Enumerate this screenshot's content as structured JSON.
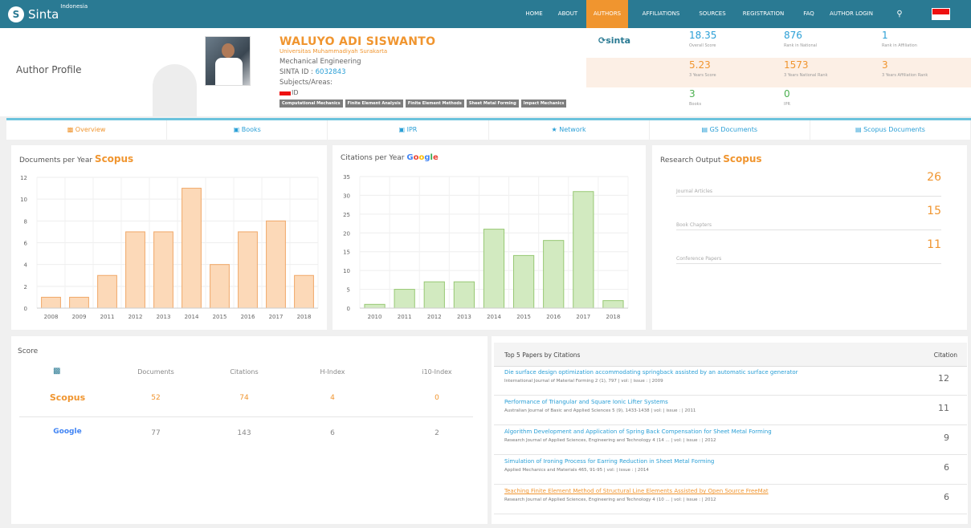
{
  "nav": {
    "logo": "Sinta",
    "logo_sub": "Indonesia",
    "items": [
      "HOME",
      "ABOUT",
      "AUTHORS",
      "AFFILIATIONS",
      "SOURCES",
      "REGISTRATION",
      "FAQ",
      "AUTHOR LOGIN"
    ],
    "active": "AUTHORS",
    "search_icon": "search-icon",
    "flag": "indonesia-flag"
  },
  "page_title": "Author Profile",
  "author": {
    "name": "WALUYO ADI SISWANTO",
    "university": "Universitas Muhammadiyah Surakarta",
    "department": "Mechanical Engineering",
    "sinta_id_label": "SINTA ID : ",
    "sinta_id": "6032843",
    "subjects_label": "Subjects/Areas:",
    "country": "ID",
    "tags": [
      "Computational Mechanics",
      "Finite Element Analysis",
      "Finite Element Methods",
      "Sheet Metal Forming",
      "Impact Mechanics"
    ]
  },
  "sinta_logo": "sinta",
  "metrics": [
    [
      {
        "value": "18.35",
        "label": "Overall Score"
      },
      {
        "value": "876",
        "label": "Rank in National"
      },
      {
        "value": "1",
        "label": "Rank in Affiliation"
      }
    ],
    [
      {
        "value": "5.23",
        "label": "3 Years Score"
      },
      {
        "value": "1573",
        "label": "3 Years National Rank"
      },
      {
        "value": "3",
        "label": "3 Years Affiliation Rank"
      }
    ],
    [
      {
        "value": "3",
        "label": "Books"
      },
      {
        "value": "0",
        "label": "IPR"
      }
    ]
  ],
  "tabs": [
    "Overview",
    "Books",
    "IPR",
    "Network",
    "GS Documents",
    "Scopus Documents"
  ],
  "active_tab": "Overview",
  "docs_card": {
    "title": "Documents per Year",
    "source": "Scopus"
  },
  "cites_card": {
    "title": "Citations per Year",
    "source": "Google"
  },
  "research_output": {
    "title": "Research Output",
    "source": "Scopus",
    "items": [
      {
        "label": "Journal Articles",
        "value": "26"
      },
      {
        "label": "Book Chapters",
        "value": "15"
      },
      {
        "label": "Conference Papers",
        "value": "11"
      }
    ]
  },
  "score": {
    "title": "Score",
    "headers": [
      "Documents",
      "Citations",
      "H-Index",
      "i10-Index"
    ],
    "rows": [
      {
        "source": "Scopus",
        "values": [
          "52",
          "74",
          "4",
          "0"
        ]
      },
      {
        "source": "Google",
        "values": [
          "77",
          "143",
          "6",
          "2"
        ]
      }
    ]
  },
  "top_papers": {
    "title": "Top 5 Papers by Citations",
    "citation_header": "Citation",
    "papers": [
      {
        "title": "Die surface design optimization accommodating springback assisted by an automatic surface generator",
        "source": "International Journal of Material Forming 2 (1), 797 | vol: | issue : | 2009",
        "citations": "12"
      },
      {
        "title": "Performance of Triangular and Square Ionic Lifter Systems",
        "source": "Australian Journal of Basic and Applied Sciences 5 (9), 1433-1438 | vol: | issue : | 2011",
        "citations": "11"
      },
      {
        "title": "Algorithm Development and Application of Spring Back Compensation for Sheet Metal Forming",
        "source": "Research Journal of Applied Sciences, Engineering and Technology 4 (14 ... | vol: | issue : | 2012",
        "citations": "9"
      },
      {
        "title": "Simulation of Ironing Process for Earring Reduction in Sheet Metal Forming",
        "source": "Applied Mechanics and Materials 465, 91-95 | vol: | issue : | 2014",
        "citations": "6"
      },
      {
        "title": "Teaching Finite Element Method of Structural Line Elements Assisted by Open Source FreeMat",
        "source": "Research Journal of Applied Sciences, Engineering and Technology 4 (10 ... | vol: | issue : | 2012",
        "citations": "6"
      }
    ]
  },
  "chart_data": [
    {
      "type": "bar",
      "title": "Documents per Year",
      "categories": [
        "2008",
        "2009",
        "2011",
        "2012",
        "2013",
        "2014",
        "2015",
        "2016",
        "2017",
        "2018"
      ],
      "values": [
        1,
        1,
        3,
        7,
        7,
        11,
        4,
        7,
        8,
        3
      ],
      "ylim": [
        0,
        12
      ],
      "yticks": [
        0,
        2,
        4,
        6,
        8,
        10,
        12
      ],
      "color": "#fcd9b8",
      "stroke": "#f0a868",
      "grid": true
    },
    {
      "type": "bar",
      "title": "Citations per Year",
      "categories": [
        "2010",
        "2011",
        "2012",
        "2013",
        "2014",
        "2015",
        "2016",
        "2017",
        "2018"
      ],
      "values": [
        1,
        5,
        7,
        7,
        21,
        14,
        18,
        31,
        2
      ],
      "ylim": [
        0,
        35
      ],
      "yticks": [
        0,
        5,
        10,
        15,
        20,
        25,
        30,
        35
      ],
      "color": "#d2eac0",
      "stroke": "#97c873",
      "grid": true
    }
  ]
}
